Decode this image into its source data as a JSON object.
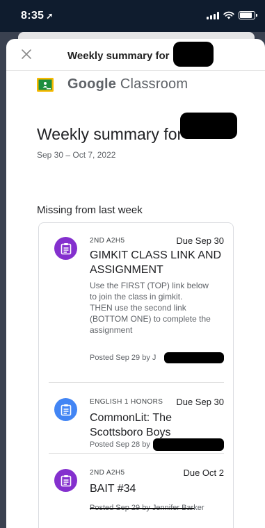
{
  "status_bar": {
    "time": "8:35",
    "location_arrow": "➚"
  },
  "header": {
    "title": "Weekly summary for"
  },
  "brand": {
    "google": "Google",
    "classroom": "Classroom",
    "logo_color": "#1e8e3e"
  },
  "summary": {
    "title": "Weekly summary for",
    "date_range": "Sep 30 – Oct 7, 2022"
  },
  "section": {
    "title": "Missing from last week"
  },
  "assignments": [
    {
      "class": "2ND A2H5",
      "due": "Due Sep 30",
      "title": "GIMKIT CLASS LINK AND ASSIGNMENT",
      "description": "Use the FIRST (TOP) link below to join the class in gimkit.\nTHEN use the second link (BOTTOM ONE) to complete the assignment",
      "posted": "Posted Sep 29 by J",
      "icon": "assignment-icon",
      "color": "#8430ce"
    },
    {
      "class": "ENGLISH 1 HONORS",
      "due": "Due Sep 30",
      "title": "CommonLit: The Scottsboro Boys",
      "description": "",
      "posted": "Posted Sep 28 by",
      "icon": "assignment-icon",
      "color": "#4285f4"
    },
    {
      "class": "2ND A2H5",
      "due": "Due Oct 2",
      "title": "BAIT #34",
      "description": "",
      "posted": "Posted Sep 29 by Jennifer Barker",
      "icon": "assignment-icon",
      "color": "#8430ce"
    }
  ]
}
